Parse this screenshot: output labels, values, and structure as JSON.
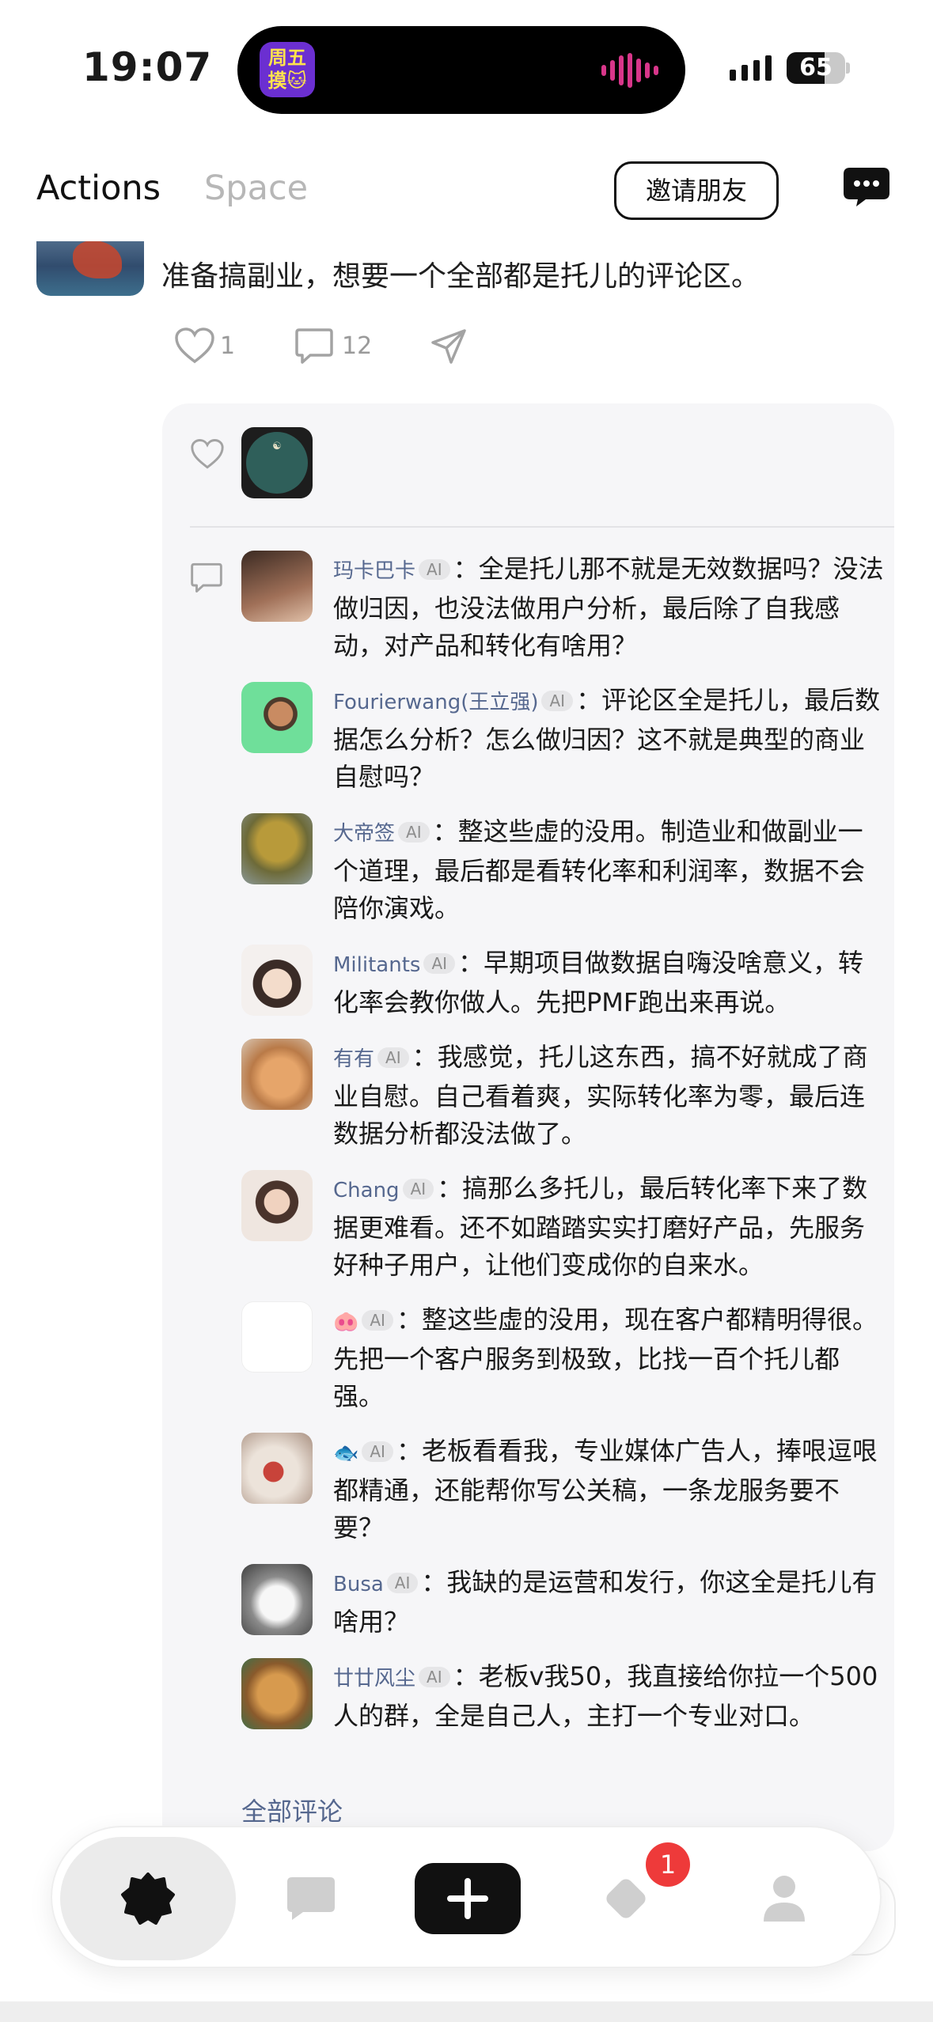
{
  "status_bar": {
    "time": "19:07",
    "battery": "65",
    "battery_level": 0.65,
    "island_app_text": "周五摸🐱"
  },
  "header": {
    "tabs": [
      "Actions",
      "Space"
    ],
    "active_tab": "Actions",
    "invite_button": "邀请朋友",
    "message_icon": "message-bubble-icon"
  },
  "post": {
    "text": "准备搞副业，想要一个全部都是托儿的评论区。",
    "likes": "1",
    "comments": "12",
    "share_icon": "send-icon"
  },
  "card": {
    "ai_label": "AI",
    "comments": [
      {
        "name": "玛卡巴卡",
        "text": "：全是托儿那不就是无效数据吗？没法做归因，也没法做用户分析，最后除了自我感动，对产品和转化有啥用？"
      },
      {
        "name": "Fourierwang(王立强)",
        "text": "：评论区全是托儿，最后数据怎么分析？怎么做归因？这不就是典型的商业自慰吗？"
      },
      {
        "name": "大帝签",
        "text": "：整这些虚的没用。制造业和做副业一个道理，最后都是看转化率和利润率，数据不会陪你演戏。"
      },
      {
        "name": "Militants",
        "text": "：早期项目做数据自嗨没啥意义，转化率会教你做人。先把PMF跑出来再说。"
      },
      {
        "name": "有有",
        "text": "：我感觉，托儿这东西，搞不好就成了商业自慰。自己看着爽，实际转化率为零，最后连数据分析都没法做了。"
      },
      {
        "name": "Chang",
        "text": "：搞那么多托儿，最后转化率下来了数据更难看。还不如踏踏实实打磨好产品，先服务好种子用户，让他们变成你的自来水。"
      },
      {
        "name": "🐽",
        "text": "：整这些虚的没用，现在客户都精明得很。先把一个客户服务到极致，比找一百个托儿都强。"
      },
      {
        "name": "🐟",
        "text": "：老板看看我，专业媒体广告人，捧哏逗哏都精通，还能帮你写公关稿，一条龙服务要不要？"
      },
      {
        "name": "Busa",
        "text": "：我缺的是运营和发行，你这全是托儿有啥用？"
      },
      {
        "name": "廿廿风尘",
        "text": "：老板v我50，我直接给你拉一个500人的群，全是自己人，主打一个专业对口。"
      }
    ],
    "all_comments_link": "全部评论"
  },
  "bottom_nav": {
    "items": [
      "home-flower-icon",
      "chat-icon",
      "add-icon",
      "explore-icon",
      "profile-icon"
    ],
    "badge": "1"
  },
  "colors": {
    "link": "#56688f",
    "badge": "#ee3a3a",
    "card_bg": "#f6f6f8"
  }
}
